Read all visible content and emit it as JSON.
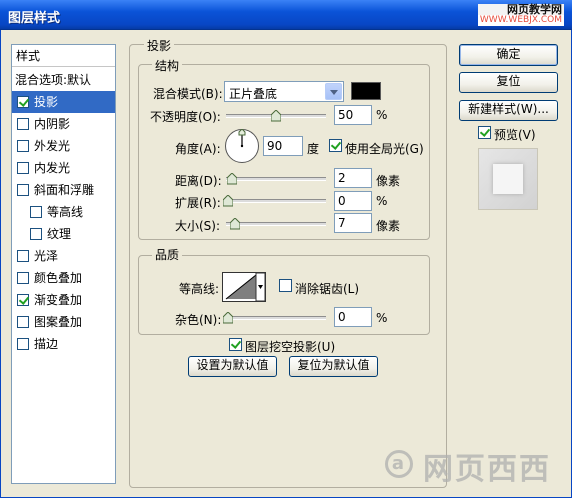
{
  "window": {
    "title": "图层样式",
    "watermark_top": "网页教学网",
    "watermark_url": "WWW.WEBJX.COM"
  },
  "styles_list": {
    "header": "样式",
    "items": [
      {
        "label": "混合选项:默认",
        "checkbox": false,
        "checked": false,
        "selected": false
      },
      {
        "label": "投影",
        "checkbox": true,
        "checked": true,
        "selected": true
      },
      {
        "label": "内阴影",
        "checkbox": true,
        "checked": false,
        "selected": false
      },
      {
        "label": "外发光",
        "checkbox": true,
        "checked": false,
        "selected": false
      },
      {
        "label": "内发光",
        "checkbox": true,
        "checked": false,
        "selected": false
      },
      {
        "label": "斜面和浮雕",
        "checkbox": true,
        "checked": false,
        "selected": false
      },
      {
        "label": "等高线",
        "checkbox": true,
        "checked": false,
        "selected": false
      },
      {
        "label": "纹理",
        "checkbox": true,
        "checked": false,
        "selected": false
      },
      {
        "label": "光泽",
        "checkbox": true,
        "checked": false,
        "selected": false
      },
      {
        "label": "颜色叠加",
        "checkbox": true,
        "checked": false,
        "selected": false
      },
      {
        "label": "渐变叠加",
        "checkbox": true,
        "checked": true,
        "selected": false
      },
      {
        "label": "图案叠加",
        "checkbox": true,
        "checked": false,
        "selected": false
      },
      {
        "label": "描边",
        "checkbox": true,
        "checked": false,
        "selected": false
      }
    ]
  },
  "shadow": {
    "title": "投影",
    "structure": {
      "title": "结构",
      "blend_mode_label": "混合模式(B):",
      "blend_mode_value": "正片叠底",
      "color": "#000000",
      "opacity_label": "不透明度(O):",
      "opacity_value": "50",
      "opacity_unit": "%",
      "angle_label": "角度(A):",
      "angle_value": "90",
      "angle_unit": "度",
      "global_light_label": "使用全局光(G)",
      "global_light_checked": true,
      "distance_label": "距离(D):",
      "distance_value": "2",
      "distance_unit": "像素",
      "spread_label": "扩展(R):",
      "spread_value": "0",
      "spread_unit": "%",
      "size_label": "大小(S):",
      "size_value": "7",
      "size_unit": "像素"
    },
    "quality": {
      "title": "品质",
      "contour_label": "等高线:",
      "antialias_label": "消除锯齿(L)",
      "antialias_checked": false,
      "noise_label": "杂色(N):",
      "noise_value": "0",
      "noise_unit": "%"
    },
    "knockout_label": "图层挖空投影(U)",
    "knockout_checked": true,
    "set_default_label": "设置为默认值",
    "reset_default_label": "复位为默认值"
  },
  "buttons": {
    "ok": "确定",
    "reset": "复位",
    "new_style": "新建样式(W)...",
    "preview_label": "预览(V)",
    "preview_checked": true
  },
  "watermark_bottom": "网页西西"
}
